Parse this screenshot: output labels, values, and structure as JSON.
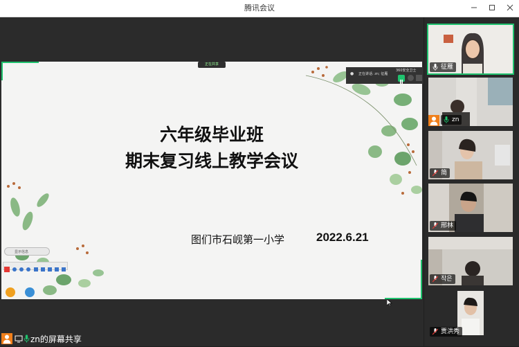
{
  "window": {
    "title": "腾讯会议",
    "minimize_icon": "minimize-icon",
    "maximize_icon": "maximize-icon",
    "close_icon": "close-icon"
  },
  "share": {
    "indicator_label": "正在共享",
    "status_text": "正在讲话: zn; 征雁",
    "stop_label": "360安全卫士",
    "footer_label": "zn的屏幕共享"
  },
  "slide": {
    "title_line1": "六年级毕业班",
    "title_line2": "期末复习线上教学会议",
    "school": "图们市石岘第一小学",
    "date": "2022.6.21",
    "toolbar_label": "显示信息"
  },
  "participants": [
    {
      "name": "征雁",
      "mic": "mic-icon",
      "host": false,
      "active": true
    },
    {
      "name": "zn",
      "mic": "mic-active-icon",
      "host": true,
      "active": false
    },
    {
      "name": "简",
      "mic": "mic-muted-icon",
      "host": false,
      "active": false
    },
    {
      "name": "邢林",
      "mic": "mic-muted-icon",
      "host": false,
      "active": false
    },
    {
      "name": "작은",
      "mic": "mic-muted-icon",
      "host": false,
      "active": false
    },
    {
      "name": "贾洪秀",
      "mic": "mic-muted-icon",
      "host": false,
      "active": false
    }
  ],
  "colors": {
    "accent": "#1fc26e",
    "host_badge": "#f07f1a",
    "background": "#2b2b2b"
  }
}
